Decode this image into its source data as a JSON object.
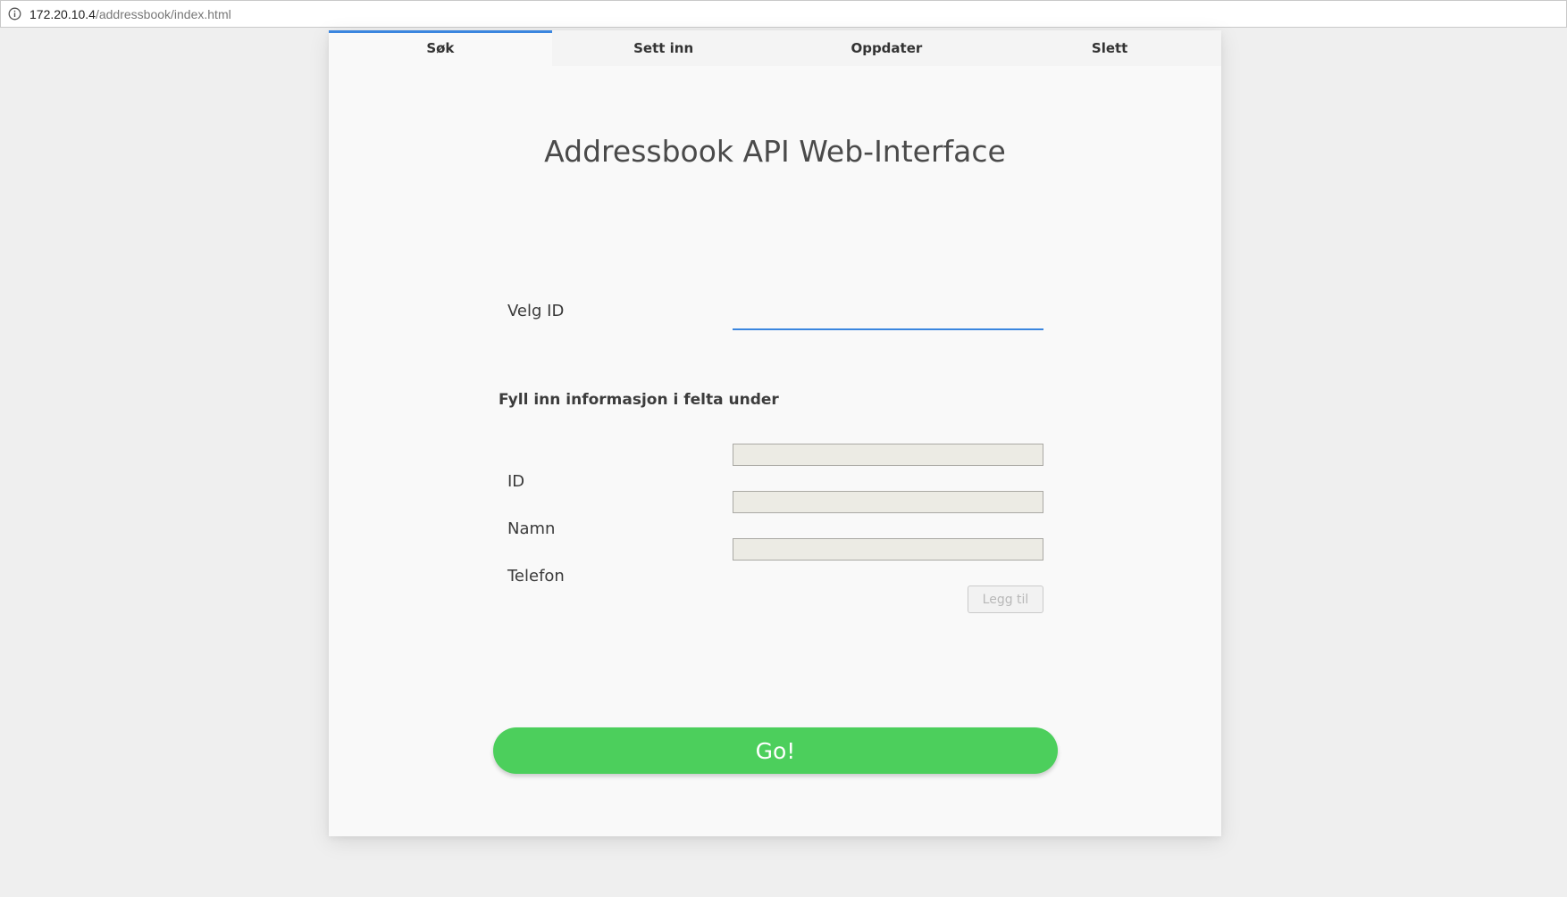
{
  "browser": {
    "url_host": "172.20.10.4",
    "url_path": "/addressbook/index.html"
  },
  "tabs": [
    {
      "label": "Søk",
      "active": true
    },
    {
      "label": "Sett inn",
      "active": false
    },
    {
      "label": "Oppdater",
      "active": false
    },
    {
      "label": "Slett",
      "active": false
    }
  ],
  "page": {
    "title": "Addressbook API Web-Interface"
  },
  "select_id": {
    "label": "Velg ID",
    "value": ""
  },
  "form": {
    "instructions": "Fyll inn informasjon i felta under",
    "fields": [
      {
        "label": "ID",
        "value": ""
      },
      {
        "label": "Namn",
        "value": ""
      },
      {
        "label": "Telefon",
        "value": ""
      }
    ],
    "add_button_label": "Legg til"
  },
  "go_button_label": "Go!",
  "colors": {
    "accent": "#3b86df",
    "go_button": "#4ccf5c",
    "disabled_input_bg": "#ecebe4"
  },
  "icons": {
    "address_bar": "info-icon"
  }
}
